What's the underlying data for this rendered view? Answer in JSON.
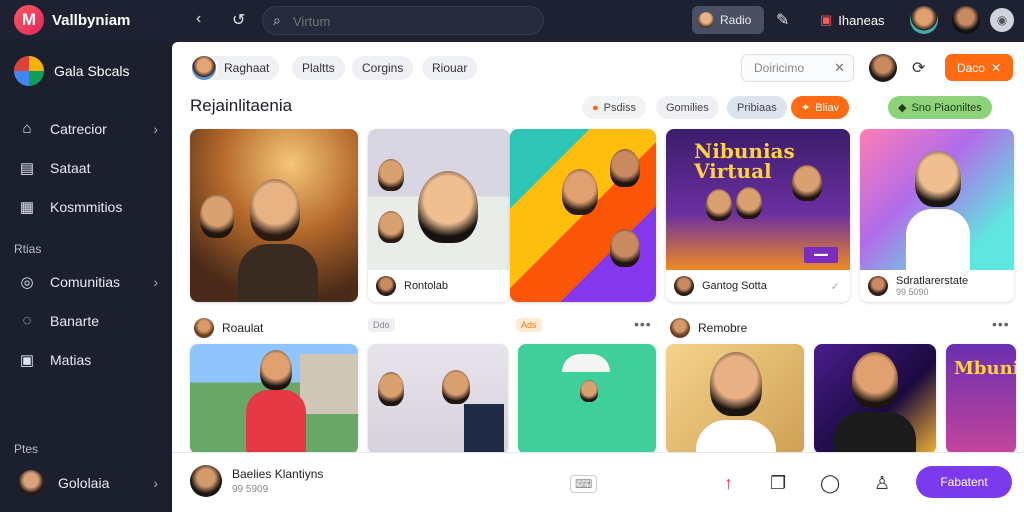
{
  "app": {
    "logo_letter": "M",
    "title": "Vallbyniam"
  },
  "topbar": {
    "search_placeholder": "Virtum",
    "radio_label": "Radio",
    "notifications_label": "Ihaneas"
  },
  "sidebar": {
    "brand": "Gala Sbcals",
    "items": [
      {
        "label": "Catrecior",
        "icon": "home-icon",
        "chevron": true
      },
      {
        "label": "Sataat",
        "icon": "inbox-icon",
        "chevron": false
      },
      {
        "label": "Kosmmitios",
        "icon": "grid-icon",
        "chevron": false
      }
    ],
    "section_1": "Rtias",
    "items_2": [
      {
        "label": "Comunitias",
        "icon": "globe-icon",
        "chevron": true
      },
      {
        "label": "Banarte",
        "icon": "chat-icon",
        "chevron": false
      },
      {
        "label": "Matias",
        "icon": "calendar-icon",
        "chevron": false
      }
    ],
    "section_2": "Ptes",
    "profile_label": "Gololaia"
  },
  "main": {
    "chips": [
      "Raghaat",
      "Plaltts",
      "Corgins",
      "Riouar"
    ],
    "filter_placeholder": "Doiricimo",
    "orange_button": "Daco",
    "section_title": "Rejainlitaenia",
    "pills": [
      {
        "label": "Psdiss",
        "style": "plain"
      },
      {
        "label": "Gomilies",
        "style": "plain"
      },
      {
        "label": "Pribiaas",
        "style": "blue"
      },
      {
        "label": "Bliav",
        "style": "orange"
      }
    ],
    "green_pill": "Sno Piaoniltes",
    "cards_row1": [
      {
        "caption": ""
      },
      {
        "caption": "Rontolab"
      },
      {
        "caption": ""
      },
      {
        "caption": "Gantog Sotta",
        "banner": "Nibunias Virtual"
      },
      {
        "caption": "Sdratlarerstate",
        "sub": "99 5090"
      }
    ],
    "row2_labels": [
      {
        "label": "Roaulat"
      },
      {
        "label": "Remobre"
      }
    ],
    "row2_tags": [
      "Ddo",
      "Ads"
    ],
    "row2_banner": "Mbuni",
    "bottom": {
      "user_name": "Baelies Klantiyns",
      "user_sub": "99 5909",
      "primary_button": "Fabatent"
    }
  }
}
